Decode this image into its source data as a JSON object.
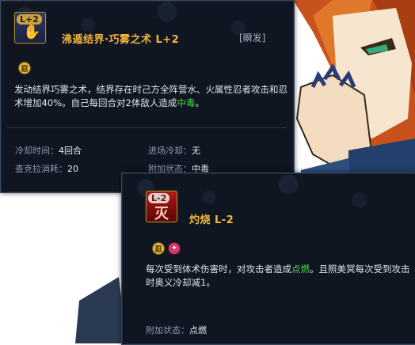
{
  "card1": {
    "level_badge": "L+2",
    "skill_name": "沸遁结界·巧雾之术  L+2",
    "tag": "[瞬发]",
    "desc_part1": "发动结界巧雾之术，结界存在时己方全阵营水、火属性忍者攻击和忍术增加40%。自己每回合对2体敌人造成",
    "desc_highlight": "中毒",
    "desc_part2": "。",
    "stats": {
      "cooldown_label": "冷却时间：",
      "cooldown_value": "4回合",
      "entry_cd_label": "进场冷却：",
      "entry_cd_value": "无",
      "chakra_label": "查克拉消耗：",
      "chakra_value": "20",
      "extra_label": "附加状态：",
      "extra_value": "中毒"
    }
  },
  "card2": {
    "level_badge": "L-2",
    "skill_name": "灼烧  L-2",
    "desc_part1": "每次受到体术伤害时，对攻击者造成",
    "desc_highlight": "点燃",
    "desc_part2": "。且照美冥每次受到攻击时奥义冷却减1。",
    "extra_label": "附加状态：",
    "extra_value": "点燃"
  },
  "colors": {
    "gold": "#f2b53a",
    "green": "#4ad84a",
    "panel_bg": "#0f1622"
  }
}
